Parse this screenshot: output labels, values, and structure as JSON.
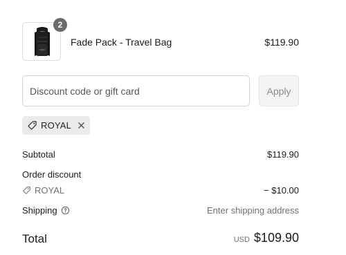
{
  "product": {
    "name": "Fade Pack - Travel Bag",
    "price": "$119.90",
    "quantity": "2",
    "image_icon": "backpack-thumbnail"
  },
  "discount": {
    "placeholder": "Discount code or gift card",
    "apply_label": "Apply",
    "applied_code": "ROYAL"
  },
  "summary": {
    "subtotal_label": "Subtotal",
    "subtotal_value": "$119.90",
    "order_discount_label": "Order discount",
    "discount_code": "ROYAL",
    "discount_value": "− $10.00",
    "shipping_label": "Shipping",
    "shipping_value": "Enter shipping address",
    "total_label": "Total",
    "currency": "USD",
    "total_value": "$109.90"
  },
  "colors": {
    "badge": "#6b6b6b",
    "chip_bg": "#ebebeb",
    "apply_bg": "#f4f4f4",
    "muted_text": "#707070"
  }
}
